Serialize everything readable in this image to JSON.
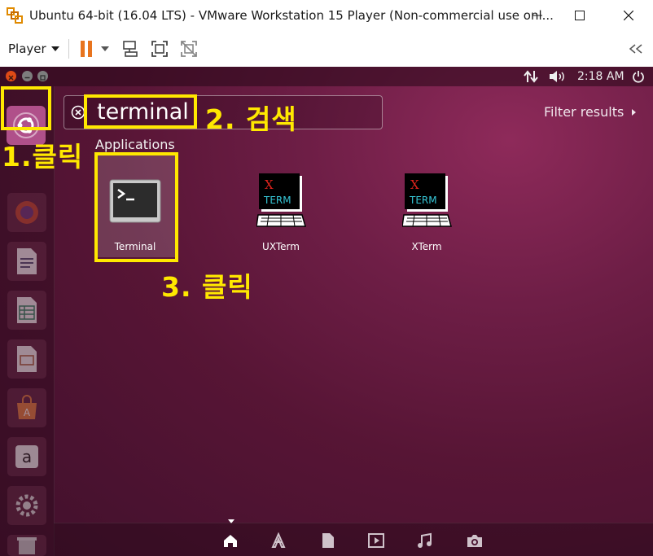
{
  "window": {
    "title": "Ubuntu 64-bit (16.04 LTS) - VMware Workstation 15 Player (Non-commercial use onl..."
  },
  "toolbar": {
    "player_menu_label": "Player",
    "pause_color": "#e8741e"
  },
  "ubuntu_panel": {
    "time": "2:18 AM"
  },
  "dash": {
    "search_value": "terminal",
    "filter_label": "Filter results",
    "section_header": "Applications",
    "apps": [
      {
        "label": "Terminal",
        "icon": "terminal-icon"
      },
      {
        "label": "UXTerm",
        "icon": "xterm-icon"
      },
      {
        "label": "XTerm",
        "icon": "xterm-icon"
      }
    ],
    "xterm_icon_text": {
      "x": "X",
      "term": "TERM"
    }
  },
  "annotations": {
    "step1": "1.클릭",
    "step2": "2. 검색",
    "step3": "3. 클릭",
    "color": "#ffe800"
  }
}
